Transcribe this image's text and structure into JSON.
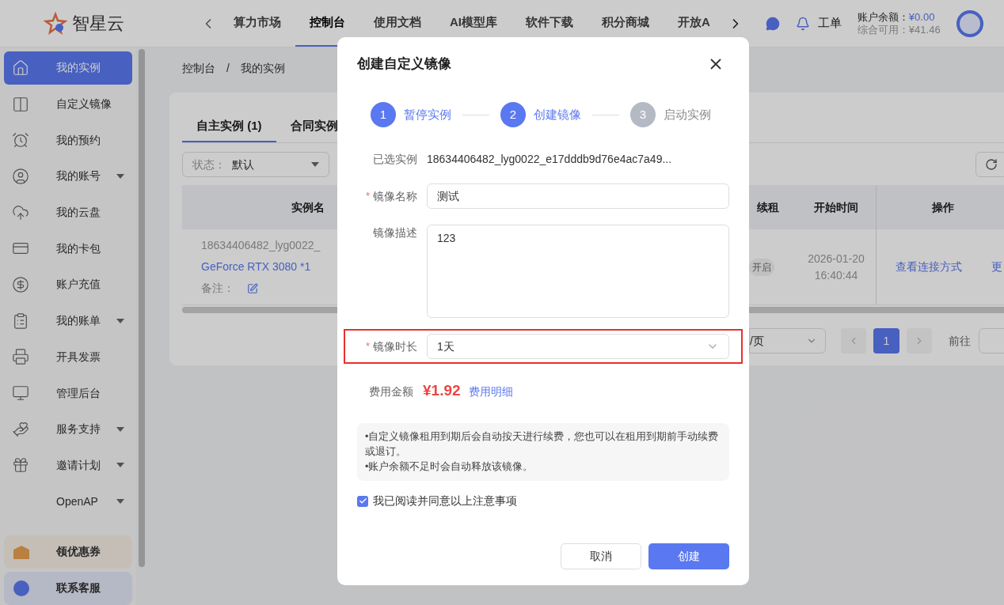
{
  "header": {
    "brand": "智星云",
    "nav": [
      {
        "label": "算力市场",
        "selected": false
      },
      {
        "label": "控制台",
        "selected": true
      },
      {
        "label": "使用文档",
        "selected": false
      },
      {
        "label": "AI模型库",
        "selected": false
      },
      {
        "label": "软件下载",
        "selected": false
      },
      {
        "label": "积分商城",
        "selected": false
      },
      {
        "label": "开放A",
        "selected": false
      }
    ],
    "ticket": "工单",
    "balance_label": "账户余额：",
    "balance": "¥0.00",
    "available_label": "综合可用：",
    "available": "¥41.46"
  },
  "sidebar": {
    "items": [
      {
        "label": "我的实例",
        "selected": true,
        "expandable": false
      },
      {
        "label": "自定义镜像",
        "selected": false,
        "expandable": false
      },
      {
        "label": "我的预约",
        "selected": false,
        "expandable": false
      },
      {
        "label": "我的账号",
        "selected": false,
        "expandable": true
      },
      {
        "label": "我的云盘",
        "selected": false,
        "expandable": false
      },
      {
        "label": "我的卡包",
        "selected": false,
        "expandable": false
      },
      {
        "label": "账户充值",
        "selected": false,
        "expandable": false
      },
      {
        "label": "我的账单",
        "selected": false,
        "expandable": true
      },
      {
        "label": "开具发票",
        "selected": false,
        "expandable": false
      },
      {
        "label": "管理后台",
        "selected": false,
        "expandable": false
      },
      {
        "label": "服务支持",
        "selected": false,
        "expandable": true
      },
      {
        "label": "邀请计划",
        "selected": false,
        "expandable": true
      },
      {
        "label": "OpenAP",
        "selected": false,
        "expandable": true
      }
    ],
    "promos": [
      {
        "label": "领优惠券"
      },
      {
        "label": "联系客服"
      }
    ]
  },
  "breadcrumb": [
    "控制台",
    "/",
    "我的实例"
  ],
  "tabs": [
    {
      "label": "自主实例 (1)",
      "selected": true
    },
    {
      "label": "合同实例",
      "selected": false
    }
  ],
  "filter": {
    "label": "状态：",
    "value": "默认"
  },
  "table": {
    "columns": [
      "实例名",
      "续租",
      "开始时间",
      "操作"
    ],
    "row": {
      "instance_id": "18634406482_lyg0022_",
      "gpu": "GeForce RTX 3080 *1",
      "note_label": "备注：",
      "renew": "开启",
      "start_time": [
        "2026-01-20",
        "16:40:44"
      ],
      "actions": [
        "查看连接方式",
        "更"
      ]
    }
  },
  "pagination": {
    "page_size": "/页",
    "pages": [
      {
        "label": "1",
        "selected": true
      }
    ],
    "goto": "前往"
  },
  "dialog": {
    "title": "创建自定义镜像",
    "required_mark": "*",
    "steps": [
      {
        "number": "1",
        "label": "暂停实例",
        "highlighted": true
      },
      {
        "number": "2",
        "label": "创建镜像",
        "highlighted": true
      },
      {
        "number": "3",
        "label": "启动实例",
        "highlighted": false
      }
    ],
    "fields": [
      {
        "kind": "text",
        "label": "已选实例",
        "required": false,
        "value": "18634406482_lyg0022_e17dddb9d76e4ac7a49..."
      },
      {
        "kind": "input",
        "label": "镜像名称",
        "required": true,
        "value": "测试"
      },
      {
        "kind": "textarea",
        "label": "镜像描述",
        "required": false,
        "value": "123"
      },
      {
        "kind": "select",
        "label": "镜像时长",
        "required": true,
        "value": "1天",
        "highlighted": true
      }
    ],
    "cost_label": "费用金额",
    "cost": "¥1.92",
    "cost_link": "费用明细",
    "notices": [
      "•自定义镜像租用到期后会自动按天进行续费，您也可以在租用到期前手动续费或退订。",
      "•账户余额不足时会自动释放该镜像。"
    ],
    "agreement": {
      "label": "我已阅读并同意以上注意事项",
      "checked": true
    },
    "buttons": [
      {
        "label": "取消",
        "kind": "secondary"
      },
      {
        "label": "创建",
        "kind": "primary"
      }
    ]
  }
}
